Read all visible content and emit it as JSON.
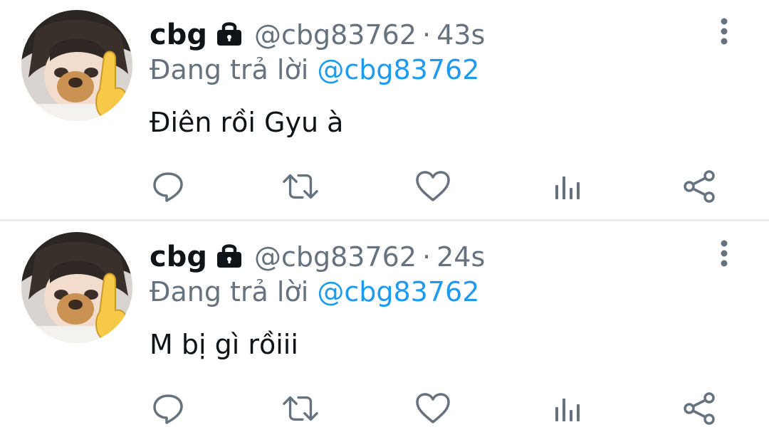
{
  "colors": {
    "text_primary": "#0f1419",
    "text_secondary": "#66727e",
    "link": "#1d9bf0",
    "icon": "#66727e",
    "divider": "#e8eaec"
  },
  "tweets": [
    {
      "display_name": "cbg",
      "verified_lock": "lock-icon",
      "handle": "@cbg83762",
      "separator": "·",
      "time": "43s",
      "reply_prefix": "Đang trả lời",
      "reply_to": "@cbg83762",
      "text": "Điên rồi Gyu à",
      "avatar": "avatar-photo",
      "actions": [
        "reply-icon",
        "retweet-icon",
        "like-icon",
        "views-icon",
        "share-icon"
      ]
    },
    {
      "display_name": "cbg",
      "verified_lock": "lock-icon",
      "handle": "@cbg83762",
      "separator": "·",
      "time": "24s",
      "reply_prefix": "Đang trả lời",
      "reply_to": "@cbg83762",
      "text": "M bị gì rồiii",
      "avatar": "avatar-photo",
      "actions": [
        "reply-icon",
        "retweet-icon",
        "like-icon",
        "views-icon",
        "share-icon"
      ]
    }
  ]
}
